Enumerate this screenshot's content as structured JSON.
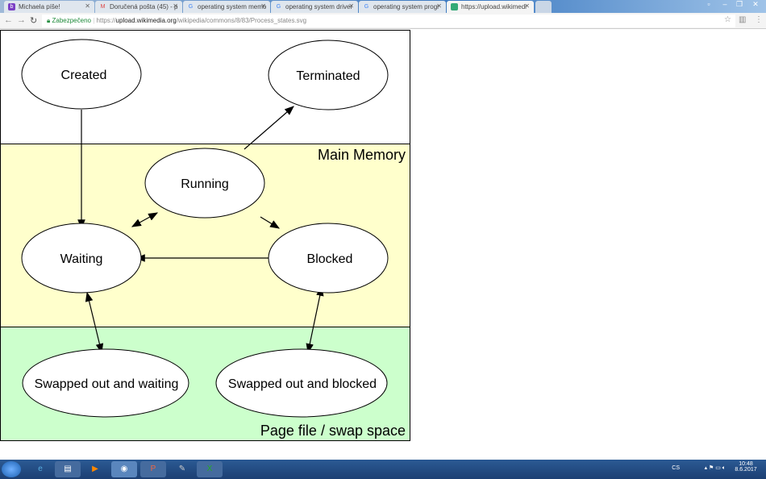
{
  "browser": {
    "tabs": [
      {
        "label": "Michaela píše!",
        "icon": "b-icon",
        "color": "#7b3fc4"
      },
      {
        "label": "Doručená pošta (45) - p",
        "icon": "gmail-icon",
        "color": "#d44"
      },
      {
        "label": "operating system memo",
        "icon": "google-icon",
        "color": "#4285f4"
      },
      {
        "label": "operating system driver",
        "icon": "google-icon",
        "color": "#4285f4"
      },
      {
        "label": "operating system progr",
        "icon": "google-icon",
        "color": "#4285f4"
      },
      {
        "label": "https://upload.wikimedi",
        "icon": "wikimedia-icon",
        "color": "#3a7"
      }
    ],
    "security_label": "Zabezpečeno",
    "url_scheme": "https://",
    "url_host": "upload.wikimedia.org",
    "url_path": "/wikipedia/commons/8/83/Process_states.svg"
  },
  "diagram": {
    "regions": {
      "main_memory": "Main Memory",
      "swap": "Page file / swap space"
    },
    "colors": {
      "top": "#ffffff",
      "main_memory": "#ffffcc",
      "swap": "#ccffcc"
    },
    "states": {
      "created": "Created",
      "terminated": "Terminated",
      "running": "Running",
      "waiting": "Waiting",
      "blocked": "Blocked",
      "swapped_waiting": "Swapped out and waiting",
      "swapped_blocked": "Swapped out and blocked"
    }
  },
  "taskbar": {
    "apps": [
      "start-icon",
      "ie-icon",
      "explorer-icon",
      "media-player-icon",
      "chrome-icon",
      "powerpoint-icon",
      "paint-icon",
      "excel-icon"
    ],
    "language": "CS",
    "time": "10:48",
    "date": "8.6.2017"
  }
}
